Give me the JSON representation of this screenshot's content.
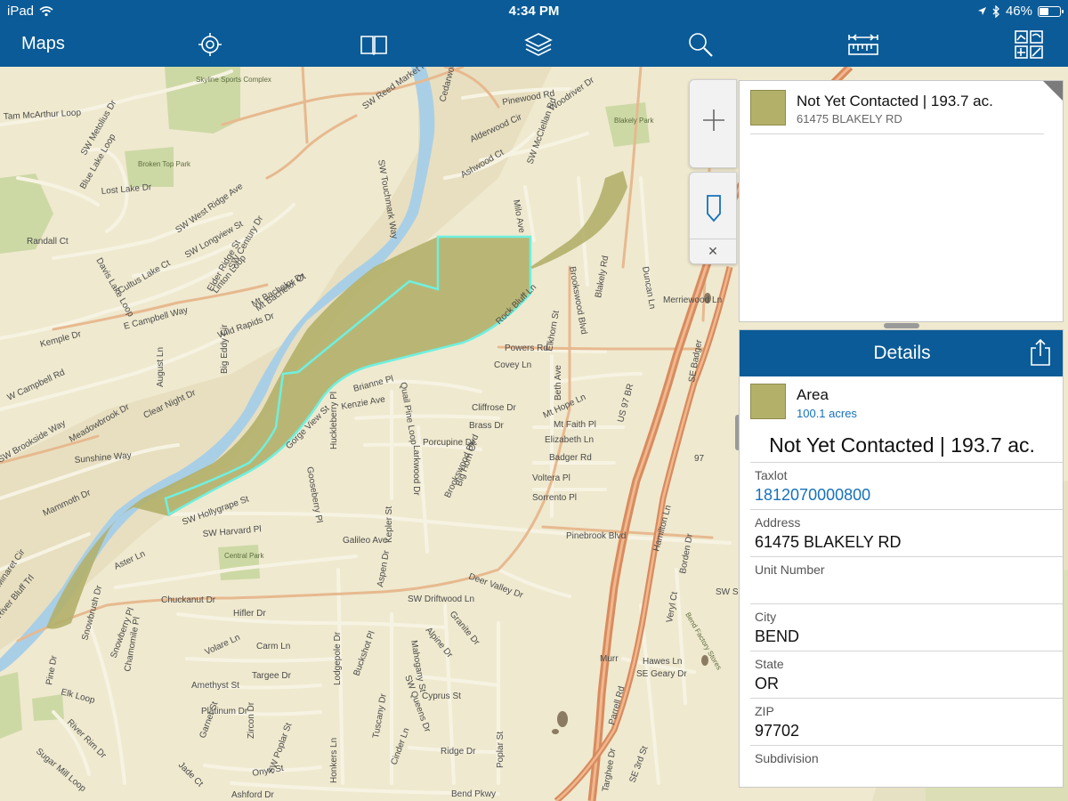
{
  "status_bar": {
    "device": "iPad",
    "time": "4:34 PM",
    "battery": "46%",
    "battery_level": 0.46
  },
  "toolbar": {
    "title": "Maps",
    "buttons": [
      "locate-icon",
      "bookmark-book-icon",
      "layers-icon",
      "search-icon",
      "measure-icon",
      "basemap-gallery-icon"
    ]
  },
  "colors": {
    "bar": "#0a5b97",
    "parcel_fill": "#b3b06a",
    "parcel_outline": "#6ff0e0",
    "river": "#a9cfe6",
    "highway": "#d98b5e",
    "park": "#cdd9a5",
    "land": "#efe9cf"
  },
  "map": {
    "street_labels": [
      "Tam McArthur Loop",
      "SW Metolius Dr",
      "Blue Lake Loop",
      "Broken Top Park",
      "Lost Lake Dr",
      "SW West Ridge Ave",
      "Davis Lake Loop",
      "SW Longview St",
      "Elder Ridge St",
      "Linton Loop",
      "SW Century Dr",
      "Randall Ct",
      "Cultus Lake Ct",
      "Mt Bachelor Dr",
      "Mt Bachelor Ct",
      "E Campbell Way",
      "Kemple Dr",
      "W Campbell Rd",
      "Wild Rapids Dr",
      "Big Eddy Cir",
      "August Ln",
      "Clear Night Dr",
      "SW Brookside Way",
      "Meadowbrook Dr",
      "Sunshine Way",
      "Mammoth Dr",
      "Minaret Cir",
      "River Bluff Trl",
      "Aster Ln",
      "Snowbrush Dr",
      "Snowberry Pl",
      "Chamomile Pl",
      "Pine Dr",
      "Elk Loop",
      "Sugar Mill Loop",
      "River Rim Dr",
      "Skyline Sports Complex",
      "SW Reed Market Rd",
      "SW Touchmark Way",
      "Cedarwood Rd",
      "Pinewood Rd",
      "Woodriver Dr",
      "Blakely Park",
      "Alderwood Cir",
      "SW McClellan Rd",
      "Ashwood Ct",
      "Milo Ave",
      "Rock Bluff Ln",
      "Brookswood Blvd",
      "Blakely Rd",
      "Duncan Ln",
      "Merriewood Ln",
      "Powers Rd",
      "Covey Ln",
      "Elkhorn St",
      "Beth Ave",
      "Mt Hope Ln",
      "Mt Faith Pl",
      "Elizabeth Ln",
      "Badger Rd",
      "Voltera Pl",
      "Sorrento Pl",
      "Brianne Pl",
      "Quail Pine Loop",
      "Kenzie Ave",
      "Cliffrose Dr",
      "Brass Dr",
      "Porcupine Dr",
      "Gorge View St",
      "Gooseberry Pl",
      "Huckleberry Pl",
      "Larkwood Dr",
      "Big Horn Ct",
      "SW Hollygrape St",
      "SW Harvard Pl",
      "Galileo Ave",
      "Kepler St",
      "Central Park",
      "Pinebrook Blvd",
      "Deer Valley Dr",
      "Brookswood Blvd",
      "Chuckanut Dr",
      "Hifler Dr",
      "Volare Ln",
      "Carm Ln",
      "Targee Dr",
      "Amethyst St",
      "Platinum Dr",
      "Garnet St",
      "Zircon Dr",
      "Jade Ct",
      "Onyx St",
      "SW Poplar St",
      "Ashford Dr",
      "Honkers Ln",
      "Lodgepole Dr",
      "Buckshot Pl",
      "Aspen Dr",
      "Tuscany Dr",
      "SW Queens Dr",
      "Mahogany St",
      "Cyprus St",
      "SW Driftwood Ln",
      "Granite Dr",
      "Alpine Dr",
      "Cinder Ln",
      "Ridge Dr",
      "Poplar St",
      "Bend Pkwy",
      "US 97 BR",
      "Hamilton Ln",
      "Borden Dr",
      "Veryl Ct",
      "Hawes Ln",
      "SE Geary Dr",
      "Parrell Rd",
      "Targhee Dr",
      "SE 3rd St",
      "SE Badger",
      "97",
      "Murr",
      "SW Sho",
      "Bend Factory Stores"
    ]
  },
  "results": {
    "item": {
      "title": "Not Yet Contacted | 193.7 ac.",
      "subtitle": "61475 BLAKELY RD"
    }
  },
  "details": {
    "header": "Details",
    "area_label": "Area",
    "area_value": "100.1 acres",
    "title": "Not Yet Contacted | 193.7 ac.",
    "fields": [
      {
        "label": "Taxlot",
        "value": "1812070000800"
      },
      {
        "label": "Address",
        "value": "61475 BLAKELY RD"
      },
      {
        "label": "Unit Number",
        "value": ""
      },
      {
        "label": "City",
        "value": "BEND"
      },
      {
        "label": "State",
        "value": "OR"
      },
      {
        "label": "ZIP",
        "value": "97702"
      },
      {
        "label": "Subdivision",
        "value": ""
      }
    ]
  }
}
